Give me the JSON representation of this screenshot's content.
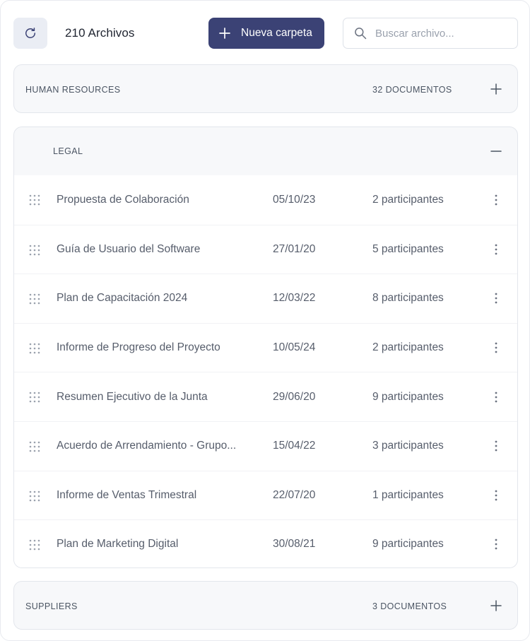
{
  "header": {
    "file_count": "210 Archivos",
    "new_folder_label": "Nueva carpeta",
    "search_placeholder": "Buscar archivo..."
  },
  "folders": [
    {
      "name": "HUMAN RESOURCES",
      "count": "32 DOCUMENTOS",
      "state": "collapsed"
    },
    {
      "name": "LEGAL",
      "count": "",
      "state": "expanded",
      "rows": [
        {
          "title": "Propuesta de Colaboración",
          "date": "05/10/23",
          "participants": "2 participantes"
        },
        {
          "title": "Guía de Usuario del Software",
          "date": "27/01/20",
          "participants": "5 participantes"
        },
        {
          "title": "Plan de Capacitación 2024",
          "date": "12/03/22",
          "participants": "8 participantes"
        },
        {
          "title": "Informe de Progreso del Proyecto",
          "date": "10/05/24",
          "participants": "2 participantes"
        },
        {
          "title": "Resumen Ejecutivo de la Junta",
          "date": "29/06/20",
          "participants": "9 participantes"
        },
        {
          "title": "Acuerdo de Arrendamiento - Grupo...",
          "date": "15/04/22",
          "participants": "3 participantes"
        },
        {
          "title": "Informe de Ventas Trimestral",
          "date": "22/07/20",
          "participants": "1 participantes"
        },
        {
          "title": "Plan de Marketing Digital",
          "date": "30/08/21",
          "participants": "9 participantes"
        }
      ]
    },
    {
      "name": "SUPPLIERS",
      "count": "3 DOCUMENTOS",
      "state": "collapsed"
    }
  ],
  "colors": {
    "accent": "#3b4275",
    "panel_bg": "#f7f8fa",
    "refresh_bg": "#eaedf4"
  },
  "icons": {
    "refresh": "refresh-icon",
    "plus": "plus-icon",
    "search": "search-icon",
    "expand": "plus-icon",
    "collapse": "minus-icon",
    "drag": "drag-handle-icon",
    "more": "more-vertical-icon"
  }
}
